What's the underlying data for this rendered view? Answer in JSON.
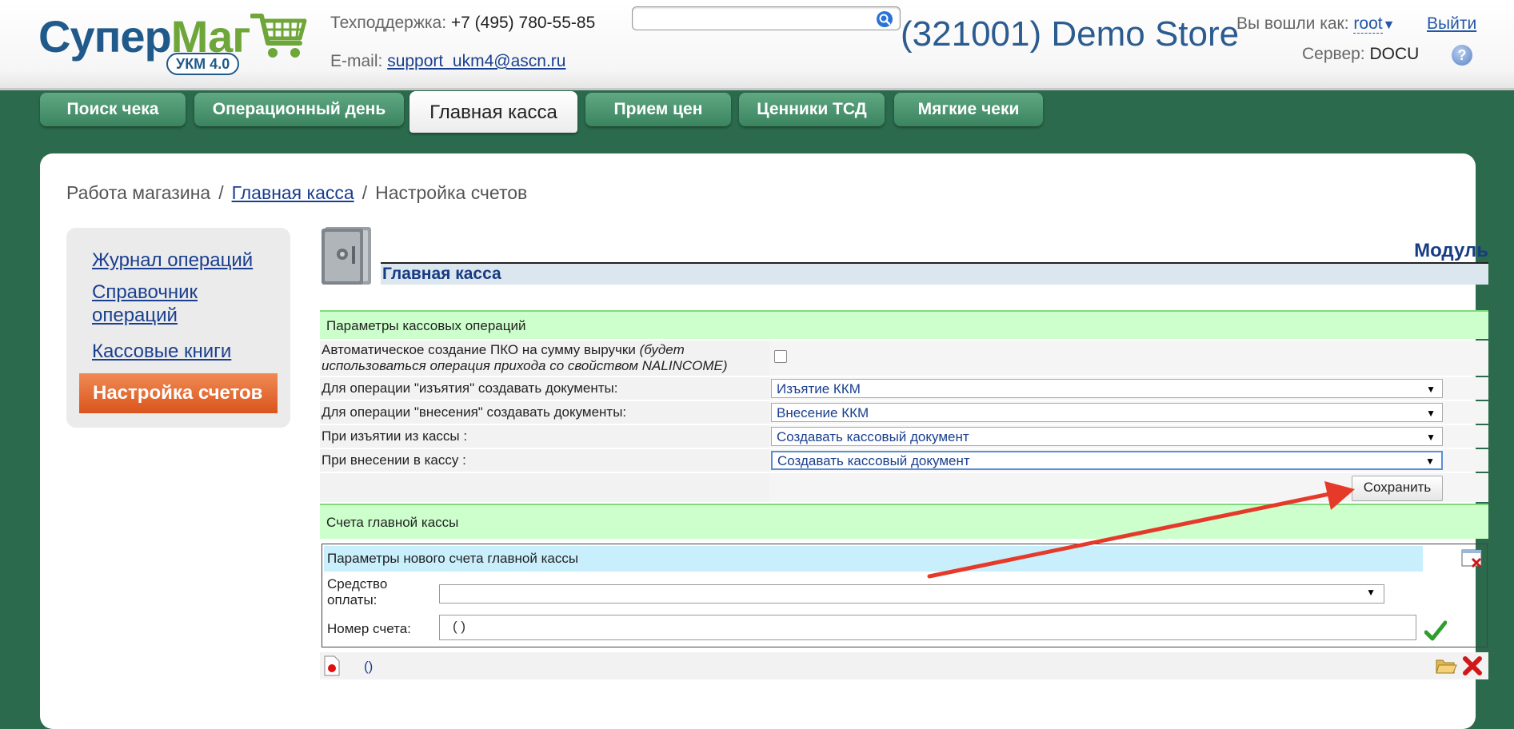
{
  "header": {
    "logo_text_1": "Супер",
    "logo_text_2": "Маг",
    "logo_badge": "УКМ 4.0",
    "support_label": "Техподдержка:",
    "support_phone": "+7 (495) 780-55-85",
    "email_label": "E-mail:",
    "email": "support_ukm4@ascn.ru",
    "search_value": "",
    "store_title": "(321001) Demo Store",
    "login_label": "Вы вошли как:",
    "user": "root",
    "logout": "Выйти",
    "server_label": "Сервер:",
    "server": "DOCU",
    "help": "?"
  },
  "tabs": [
    {
      "label": "Поиск чека"
    },
    {
      "label": "Операционный день"
    },
    {
      "label": "Главная касса",
      "active": true
    },
    {
      "label": "Прием цен"
    },
    {
      "label": "Ценники ТСД"
    },
    {
      "label": "Мягкие чеки"
    }
  ],
  "breadcrumb": {
    "root": "Работа магазина",
    "link": "Главная касса",
    "current": "Настройка счетов"
  },
  "sidebar": {
    "items": [
      {
        "label": "Журнал операций"
      },
      {
        "label": "Справочник операций"
      },
      {
        "label": "Кассовые книги"
      },
      {
        "label": "Настройка счетов",
        "active": true
      }
    ]
  },
  "module": {
    "title": "Модуль",
    "name": "Главная касса"
  },
  "params": {
    "header": "Параметры кассовых операций",
    "auto_pko_label": "Автоматическое создание ПКО на сумму выручки",
    "auto_pko_note": "(будет использоваться операция прихода со свойством NALINCOME)",
    "auto_pko_checked": false,
    "withdraw_label": "Для операции \"изъятия\" создавать документы:",
    "withdraw_value": "Изъятие ККМ",
    "deposit_label": "Для операции \"внесения\" создавать документы:",
    "deposit_value": "Внесение ККМ",
    "on_withdraw_label": "При изъятии из кассы :",
    "on_withdraw_value": "Создавать кассовый документ",
    "on_deposit_label": "При внесении в кассу :",
    "on_deposit_value": "Создавать кассовый документ",
    "save": "Сохранить"
  },
  "accounts": {
    "header": "Счета главной кассы",
    "new_header": "Параметры нового счета главной кассы",
    "payment_label": "Средство оплаты:",
    "payment_value": "",
    "account_label": "Номер счета:",
    "account_value": "( )",
    "row_value": "()"
  },
  "colors": {
    "background": "#2b6a4c",
    "tab": "#4a9570",
    "accent_orange": "#e66a2e",
    "section_green": "#ccffcc",
    "section_blue": "#c9effc",
    "annotation_arrow": "#e53a2a"
  }
}
